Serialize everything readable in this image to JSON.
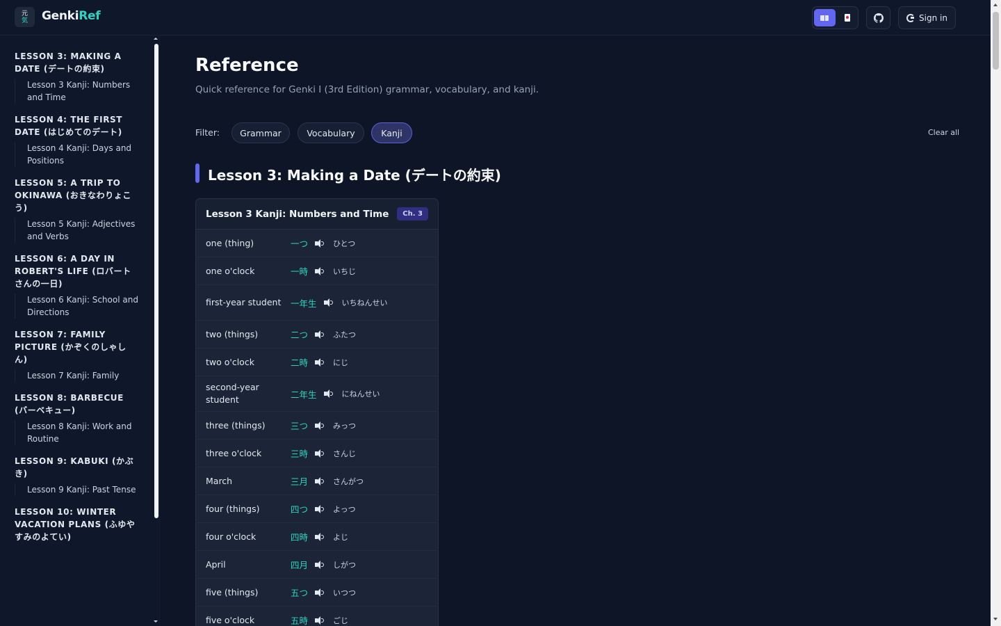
{
  "header": {
    "logo_line1": "元",
    "logo_line2": "気",
    "brand_part1": "Genki",
    "brand_part2": "Ref",
    "github_icon": "github-icon",
    "signin_label": "Sign in",
    "accent_color": "#6366f1",
    "teal_color": "#2dd4bf"
  },
  "sidebar": {
    "groups": [
      {
        "heading": "Lesson 3: Making a Date (デートの約束)",
        "item": "Lesson 3 Kanji: Numbers and Time"
      },
      {
        "heading": "Lesson 4: The First Date (はじめてのデート)",
        "item": "Lesson 4 Kanji: Days and Positions"
      },
      {
        "heading": "Lesson 5: A Trip to Okinawa (おきなわりょこう)",
        "item": "Lesson 5 Kanji: Adjectives and Verbs"
      },
      {
        "heading": "Lesson 6: A Day in Robert's Life (ロバートさんの一日)",
        "item": "Lesson 6 Kanji: School and Directions"
      },
      {
        "heading": "Lesson 7: Family Picture (かぞくのしゃしん)",
        "item": "Lesson 7 Kanji: Family"
      },
      {
        "heading": "Lesson 8: Barbecue (バーベキュー)",
        "item": "Lesson 8 Kanji: Work and Routine"
      },
      {
        "heading": "Lesson 9: Kabuki (かぶき)",
        "item": "Lesson 9 Kanji: Past Tense"
      },
      {
        "heading": "Lesson 10: Winter Vacation Plans (ふゆやすみのよてい)",
        "item": ""
      }
    ]
  },
  "main": {
    "title": "Reference",
    "subtitle": "Quick reference for Genki I (3rd Edition) grammar, vocabulary, and kanji.",
    "filter_label": "Filter:",
    "filters": [
      {
        "label": "Grammar",
        "active": false
      },
      {
        "label": "Vocabulary",
        "active": false
      },
      {
        "label": "Kanji",
        "active": true
      }
    ],
    "clear_all": "Clear all",
    "section_title": "Lesson 3: Making a Date (デートの約束)",
    "card": {
      "title": "Lesson 3 Kanji: Numbers and Time",
      "badge": "Ch. 3",
      "rows": [
        {
          "english": "one (thing)",
          "kanji": "一つ",
          "kana": "ひとつ"
        },
        {
          "english": "one o'clock",
          "kanji": "一時",
          "kana": "いちじ"
        },
        {
          "english": "first-year student",
          "kanji": "一年生",
          "kana": "いちねんせい"
        },
        {
          "english": "two (things)",
          "kanji": "二つ",
          "kana": "ふたつ"
        },
        {
          "english": "two o'clock",
          "kanji": "二時",
          "kana": "にじ"
        },
        {
          "english": "second-year student",
          "kanji": "二年生",
          "kana": "にねんせい"
        },
        {
          "english": "three (things)",
          "kanji": "三つ",
          "kana": "みっつ"
        },
        {
          "english": "three o'clock",
          "kanji": "三時",
          "kana": "さんじ"
        },
        {
          "english": "March",
          "kanji": "三月",
          "kana": "さんがつ"
        },
        {
          "english": "four (things)",
          "kanji": "四つ",
          "kana": "よっつ"
        },
        {
          "english": "four o'clock",
          "kanji": "四時",
          "kana": "よじ"
        },
        {
          "english": "April",
          "kanji": "四月",
          "kana": "しがつ"
        },
        {
          "english": "five (things)",
          "kanji": "五つ",
          "kana": "いつつ"
        },
        {
          "english": "five o'clock",
          "kanji": "五時",
          "kana": "ごじ"
        }
      ]
    }
  }
}
